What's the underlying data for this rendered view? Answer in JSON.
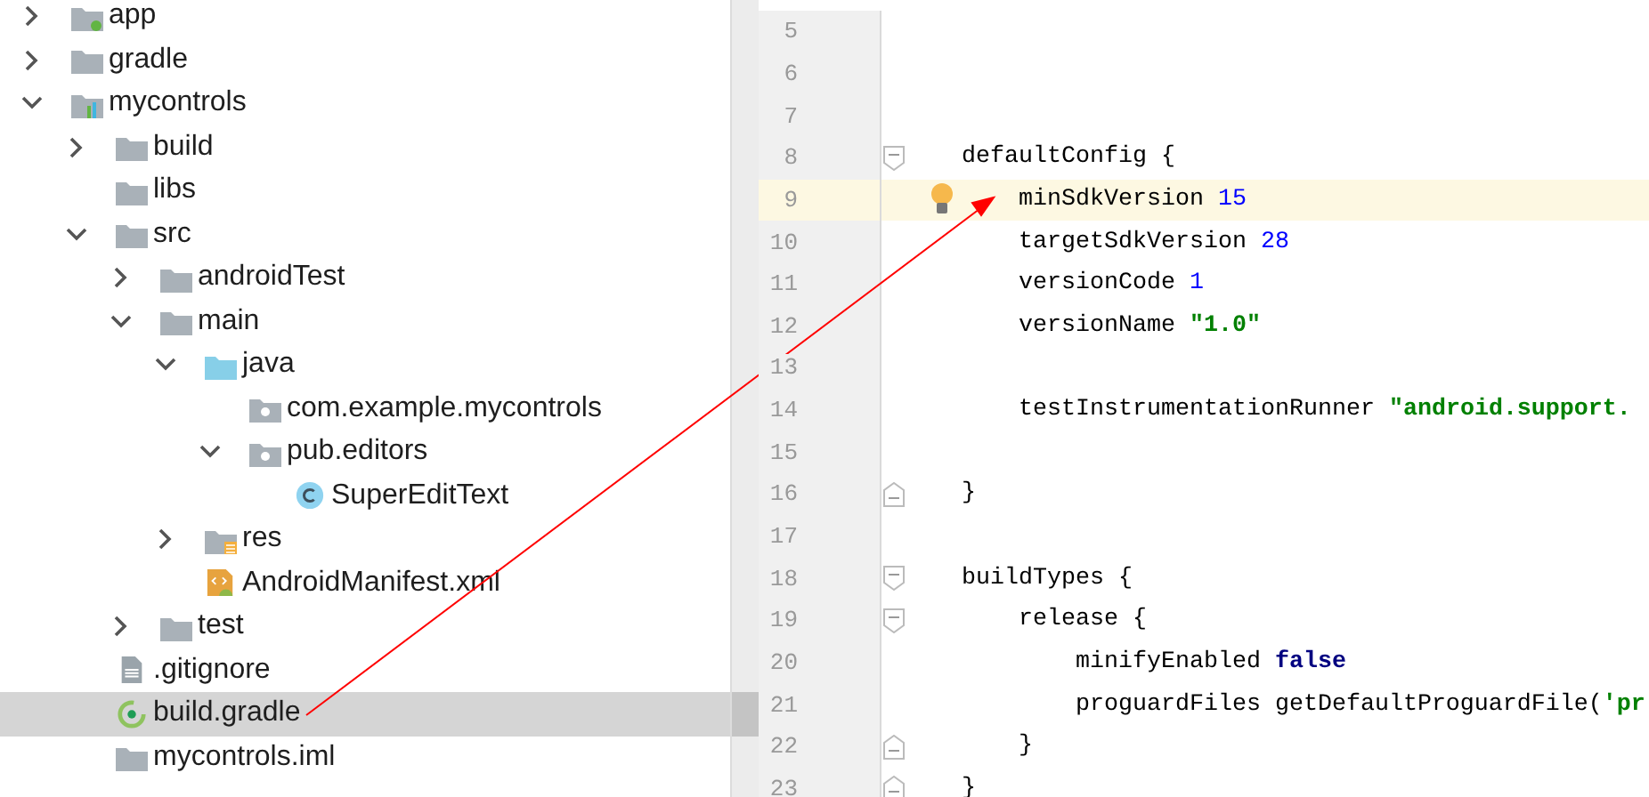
{
  "project_tree": {
    "items": [
      {
        "name": "app",
        "kind": "module-app",
        "expanded": false,
        "selected": false
      },
      {
        "name": "gradle",
        "kind": "folder",
        "expanded": false,
        "selected": false
      },
      {
        "name": "mycontrols",
        "kind": "module",
        "expanded": true,
        "selected": false,
        "children": [
          {
            "name": "build",
            "kind": "folder",
            "expanded": false,
            "selected": false
          },
          {
            "name": "libs",
            "kind": "folder",
            "selected": false
          },
          {
            "name": "src",
            "kind": "folder",
            "expanded": true,
            "selected": false,
            "children": [
              {
                "name": "androidTest",
                "kind": "folder",
                "expanded": false,
                "selected": false
              },
              {
                "name": "main",
                "kind": "folder",
                "expanded": true,
                "selected": false,
                "children": [
                  {
                    "name": "java",
                    "kind": "source-folder",
                    "expanded": true,
                    "selected": false,
                    "children": [
                      {
                        "name": "com.example.mycontrols",
                        "kind": "package",
                        "selected": false
                      },
                      {
                        "name": "pub.editors",
                        "kind": "package",
                        "expanded": true,
                        "selected": false,
                        "children": [
                          {
                            "name": "SuperEditText",
                            "kind": "class",
                            "selected": false
                          }
                        ]
                      }
                    ]
                  },
                  {
                    "name": "res",
                    "kind": "res-folder",
                    "expanded": false,
                    "selected": false
                  },
                  {
                    "name": "AndroidManifest.xml",
                    "kind": "manifest",
                    "selected": false
                  }
                ]
              },
              {
                "name": "test",
                "kind": "folder",
                "expanded": false,
                "selected": false
              }
            ]
          },
          {
            "name": ".gitignore",
            "kind": "text-file",
            "selected": false
          },
          {
            "name": "build.gradle",
            "kind": "gradle",
            "selected": true
          },
          {
            "name": "mycontrols.iml",
            "kind": "iml",
            "selected": false
          }
        ]
      }
    ]
  },
  "editor": {
    "lines": [
      {
        "number": "5",
        "current": false
      },
      {
        "number": "6",
        "current": false
      },
      {
        "number": "7",
        "current": false
      },
      {
        "number": "8",
        "current": false,
        "markers": [
          {
            "kind": "fold-start"
          }
        ],
        "segments": [
          {
            "kind": "plain",
            "text": "    defaultConfig {"
          }
        ]
      },
      {
        "number": "9",
        "current": true,
        "markers": [
          {
            "kind": "bulb"
          }
        ],
        "segments": [
          {
            "kind": "plain",
            "text": "        minSdkVersion "
          },
          {
            "kind": "number",
            "text": "15"
          }
        ]
      },
      {
        "number": "10",
        "current": false,
        "segments": [
          {
            "kind": "plain",
            "text": "        targetSdkVersion "
          },
          {
            "kind": "number",
            "text": "28"
          }
        ]
      },
      {
        "number": "11",
        "current": false,
        "segments": [
          {
            "kind": "plain",
            "text": "        versionCode "
          },
          {
            "kind": "number",
            "text": "1"
          }
        ]
      },
      {
        "number": "12",
        "current": false,
        "segments": [
          {
            "kind": "plain",
            "text": "        versionName "
          },
          {
            "kind": "string",
            "text": "\"1.0\""
          }
        ]
      },
      {
        "number": "13",
        "current": false
      },
      {
        "number": "14",
        "current": false,
        "segments": [
          {
            "kind": "plain",
            "text": "        testInstrumentationRunner "
          },
          {
            "kind": "string",
            "text": "\"android.support."
          }
        ]
      },
      {
        "number": "15",
        "current": false
      },
      {
        "number": "16",
        "current": false,
        "markers": [
          {
            "kind": "fold-end"
          }
        ],
        "segments": [
          {
            "kind": "plain",
            "text": "    }"
          }
        ]
      },
      {
        "number": "17",
        "current": false
      },
      {
        "number": "18",
        "current": false,
        "markers": [
          {
            "kind": "fold-start"
          }
        ],
        "segments": [
          {
            "kind": "plain",
            "text": "    buildTypes {"
          }
        ]
      },
      {
        "number": "19",
        "current": false,
        "markers": [
          {
            "kind": "fold-start"
          }
        ],
        "segments": [
          {
            "kind": "plain",
            "text": "        release {"
          }
        ]
      },
      {
        "number": "20",
        "current": false,
        "segments": [
          {
            "kind": "plain",
            "text": "            minifyEnabled "
          },
          {
            "kind": "keyword",
            "text": "false"
          }
        ]
      },
      {
        "number": "21",
        "current": false,
        "segments": [
          {
            "kind": "plain",
            "text": "            proguardFiles getDefaultProguardFile("
          },
          {
            "kind": "string",
            "text": "'pr"
          }
        ]
      },
      {
        "number": "22",
        "current": false,
        "markers": [
          {
            "kind": "fold-end"
          }
        ],
        "segments": [
          {
            "kind": "plain",
            "text": "        }"
          }
        ]
      },
      {
        "number": "23",
        "current": false,
        "markers": [
          {
            "kind": "fold-end"
          }
        ],
        "segments": [
          {
            "kind": "plain",
            "text": "    }"
          }
        ]
      }
    ]
  }
}
